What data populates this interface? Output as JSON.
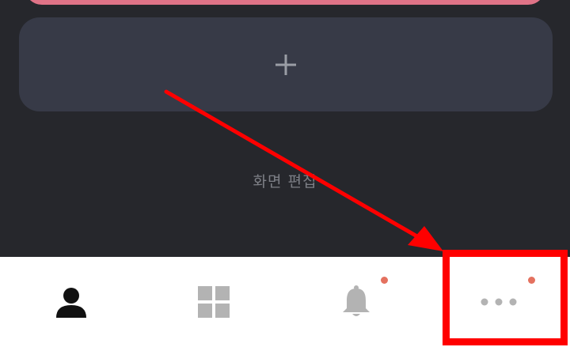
{
  "colors": {
    "background": "#26272c",
    "pink_card": "#e07387",
    "add_card": "#373a47",
    "add_icon": "#9a9da5",
    "edit_text": "#7d7f86",
    "nav_background": "#ffffff",
    "profile_active": "#111111",
    "inactive_icon": "#b3b3b3",
    "badge": "#e4715f",
    "annotation": "#ff0000"
  },
  "add_card": {
    "icon": "plus-icon"
  },
  "edit_screen": {
    "label": "화면 편집"
  },
  "bottom_nav": {
    "items": [
      {
        "icon": "person-icon",
        "active": true,
        "badge": false
      },
      {
        "icon": "grid-icon",
        "active": false,
        "badge": false
      },
      {
        "icon": "bell-icon",
        "active": false,
        "badge": true
      },
      {
        "icon": "more-icon",
        "active": false,
        "badge": true
      }
    ]
  },
  "annotation": {
    "type": "arrow-to-highlight-box",
    "target": "more-icon"
  }
}
